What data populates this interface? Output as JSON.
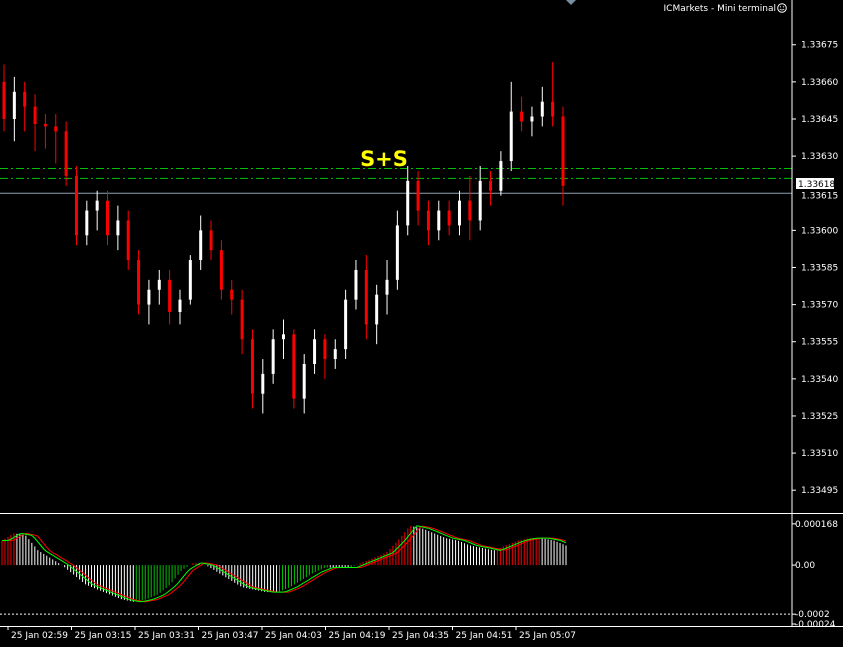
{
  "header": {
    "terminal_label": "ICMarkets - Mini terminal",
    "terminal_icon": "smiley-icon"
  },
  "annotation": {
    "text": "S+S",
    "color": "#ffff00"
  },
  "colors": {
    "background": "#000000",
    "bull": "#ffffff",
    "bear": "#ff0000",
    "bid_line": "#8fa0ae",
    "level_line": "#00c000",
    "signal_line": "#00ff00",
    "badge_bg": "#ffffff"
  },
  "chart_data": [
    {
      "type": "candlestick",
      "ylim": [
        1.33487,
        1.33685
      ],
      "y_ticks": [
        "1.33675",
        "1.33660",
        "1.33645",
        "1.33630",
        "1.33600",
        "1.33585",
        "1.33570",
        "1.33555",
        "1.33540",
        "1.33525",
        "1.33510",
        "1.33495"
      ],
      "x_ticks": [
        "25 Jan 02:59",
        "25 Jan 03:15",
        "25 Jan 03:31",
        "25 Jan 03:47",
        "25 Jan 04:03",
        "25 Jan 04:19",
        "25 Jan 04:35",
        "25 Jan 04:51",
        "25 Jan 05:07"
      ],
      "last_price": "1.33618",
      "bid_line_label": "1.33615",
      "levels": [
        1.33625,
        1.33621
      ],
      "candles": [
        [
          1.3366,
          1.33667,
          1.3364,
          1.33645
        ],
        [
          1.33645,
          1.33662,
          1.33636,
          1.33656
        ],
        [
          1.33656,
          1.3366,
          1.3364,
          1.3365
        ],
        [
          1.3365,
          1.33655,
          1.33632,
          1.33643
        ],
        [
          1.33643,
          1.33647,
          1.33633,
          1.33642
        ],
        [
          1.33642,
          1.33647,
          1.33627,
          1.3364
        ],
        [
          1.3364,
          1.33644,
          1.33618,
          1.33622
        ],
        [
          1.33622,
          1.33626,
          1.33594,
          1.33598
        ],
        [
          1.33598,
          1.33612,
          1.33594,
          1.33608
        ],
        [
          1.33608,
          1.33616,
          1.336,
          1.33612
        ],
        [
          1.33612,
          1.33616,
          1.33594,
          1.33598
        ],
        [
          1.33598,
          1.3361,
          1.33592,
          1.33604
        ],
        [
          1.33604,
          1.33608,
          1.33584,
          1.33588
        ],
        [
          1.33588,
          1.33592,
          1.33566,
          1.3357
        ],
        [
          1.3357,
          1.3358,
          1.33562,
          1.33576
        ],
        [
          1.33576,
          1.33584,
          1.3357,
          1.3358
        ],
        [
          1.3358,
          1.33584,
          1.33562,
          1.33567
        ],
        [
          1.33567,
          1.33576,
          1.33562,
          1.33572
        ],
        [
          1.33572,
          1.3359,
          1.3357,
          1.33588
        ],
        [
          1.33588,
          1.33606,
          1.33584,
          1.336
        ],
        [
          1.336,
          1.33604,
          1.33588,
          1.33592
        ],
        [
          1.33592,
          1.33596,
          1.33572,
          1.33576
        ],
        [
          1.33576,
          1.3358,
          1.33566,
          1.33572
        ],
        [
          1.33572,
          1.33576,
          1.3355,
          1.33556
        ],
        [
          1.33556,
          1.3356,
          1.33528,
          1.33534
        ],
        [
          1.33534,
          1.33548,
          1.33526,
          1.33542
        ],
        [
          1.33542,
          1.3356,
          1.33538,
          1.33556
        ],
        [
          1.33556,
          1.33564,
          1.33548,
          1.33558
        ],
        [
          1.33558,
          1.3356,
          1.33528,
          1.33532
        ],
        [
          1.33532,
          1.3355,
          1.33526,
          1.33546
        ],
        [
          1.33546,
          1.3356,
          1.33542,
          1.33556
        ],
        [
          1.33556,
          1.33558,
          1.3354,
          1.33548
        ],
        [
          1.33548,
          1.33556,
          1.33544,
          1.33552
        ],
        [
          1.33552,
          1.33576,
          1.33548,
          1.33572
        ],
        [
          1.33572,
          1.33588,
          1.33568,
          1.33584
        ],
        [
          1.33584,
          1.3359,
          1.33556,
          1.33562
        ],
        [
          1.33562,
          1.33578,
          1.33554,
          1.33574
        ],
        [
          1.33574,
          1.33588,
          1.33566,
          1.3358
        ],
        [
          1.3358,
          1.33608,
          1.33576,
          1.33602
        ],
        [
          1.33602,
          1.33626,
          1.33598,
          1.3362
        ],
        [
          1.3362,
          1.33624,
          1.33602,
          1.33608
        ],
        [
          1.33608,
          1.33612,
          1.33594,
          1.336
        ],
        [
          1.336,
          1.33612,
          1.33596,
          1.33608
        ],
        [
          1.33608,
          1.33612,
          1.33598,
          1.33602
        ],
        [
          1.33602,
          1.33616,
          1.33598,
          1.33612
        ],
        [
          1.33612,
          1.33622,
          1.33596,
          1.33604
        ],
        [
          1.33604,
          1.33626,
          1.336,
          1.3362
        ],
        [
          1.3362,
          1.33624,
          1.3361,
          1.33616
        ],
        [
          1.33616,
          1.33632,
          1.33614,
          1.33628
        ],
        [
          1.33628,
          1.3366,
          1.33624,
          1.33648
        ],
        [
          1.33648,
          1.33654,
          1.3364,
          1.33644
        ],
        [
          1.33644,
          1.3365,
          1.33638,
          1.33646
        ],
        [
          1.33646,
          1.33658,
          1.33642,
          1.33652
        ],
        [
          1.33652,
          1.33668,
          1.33642,
          1.33646
        ],
        [
          1.33646,
          1.3365,
          1.3361,
          1.33618
        ]
      ]
    },
    {
      "type": "histogram-oscillator",
      "ylim": [
        -0.00024,
        0.0002
      ],
      "y_ticks": [
        "0.000168",
        "0.00",
        "-0.0002",
        "-0.00024"
      ],
      "values": [
        0.0001,
        0.00013,
        0.00012,
        6e-05,
        3e-05,
        0.0,
        -4e-05,
        -8e-05,
        -0.0001,
        -0.00012,
        -0.00014,
        -0.00015,
        -0.00014,
        -0.00012,
        -8e-05,
        -2e-05,
        1e-05,
        0.0,
        -3e-05,
        -6e-05,
        -9e-05,
        -0.0001,
        -0.00011,
        -0.00011,
        -9e-05,
        -6e-05,
        -3e-05,
        -1e-05,
        -1e-05,
        -1e-05,
        1e-05,
        3e-05,
        5e-05,
        0.0001,
        0.00016,
        0.00015,
        0.00013,
        0.00011,
        0.0001,
        8e-05,
        7e-05,
        6e-05,
        8e-05,
        0.0001,
        0.00011,
        0.00011,
        0.0001,
        8e-05
      ]
    }
  ]
}
